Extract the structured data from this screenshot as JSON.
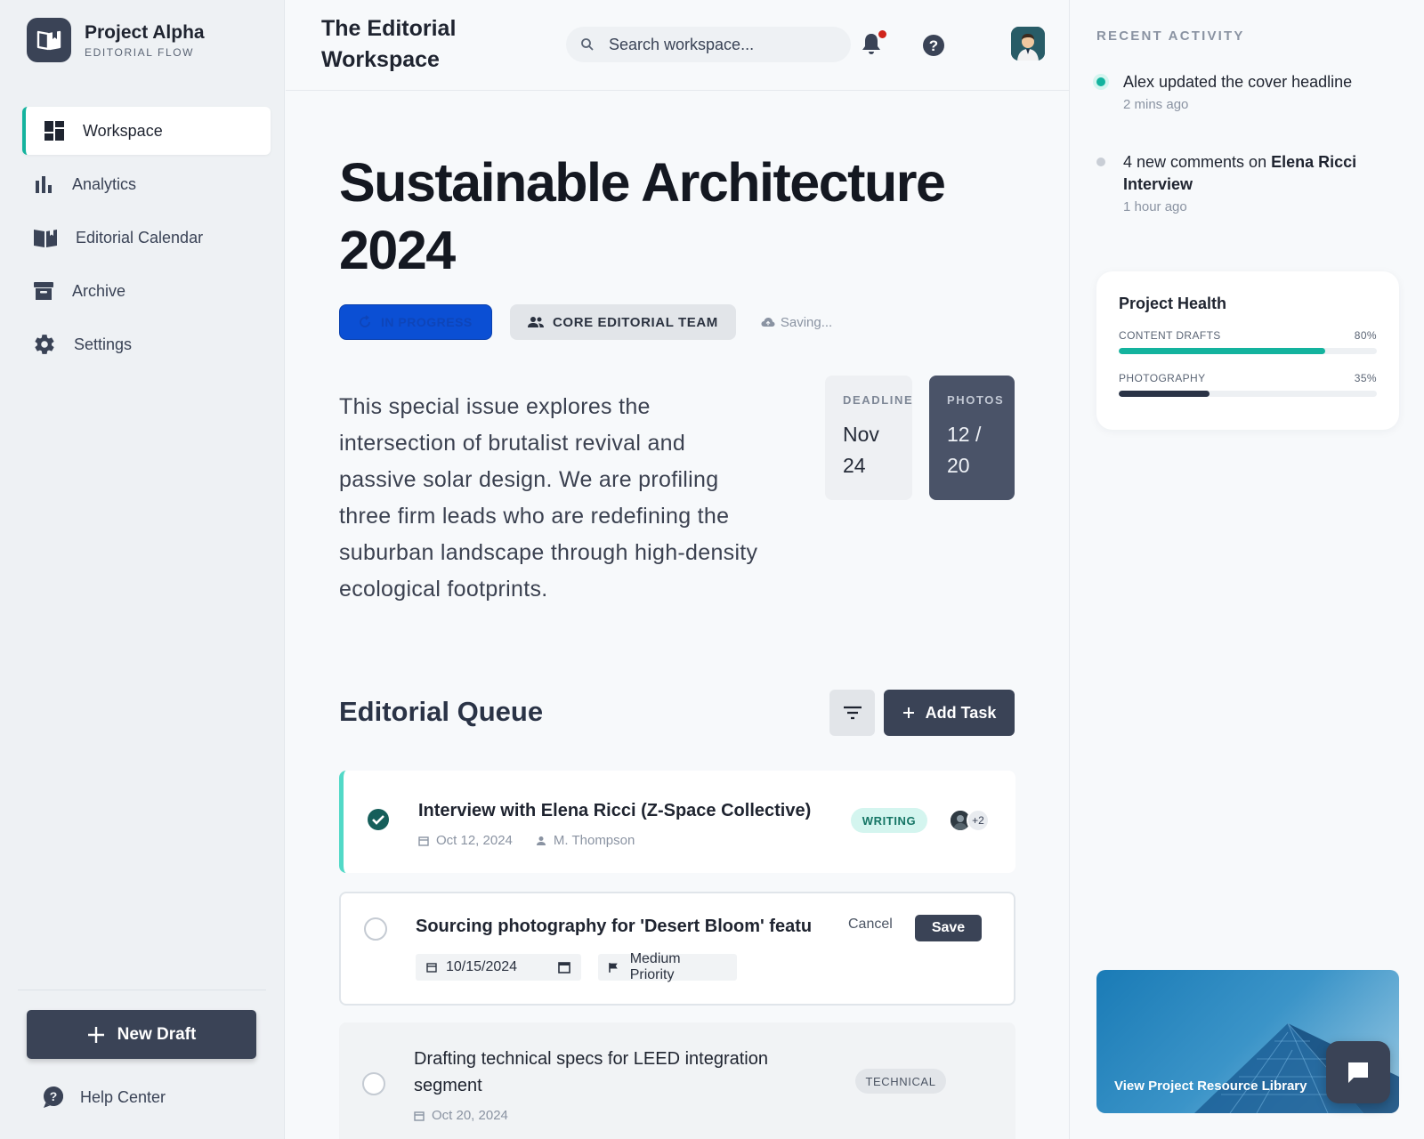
{
  "brand": {
    "title": "Project Alpha",
    "subtitle": "EDITORIAL FLOW"
  },
  "sidebar": {
    "items": [
      {
        "label": "Workspace",
        "icon": "dashboard-icon",
        "active": true
      },
      {
        "label": "Analytics",
        "icon": "bar-chart-icon"
      },
      {
        "label": "Editorial Calendar",
        "icon": "book-icon"
      },
      {
        "label": "Archive",
        "icon": "archive-icon"
      },
      {
        "label": "Settings",
        "icon": "gear-icon"
      }
    ],
    "new_draft_label": "New Draft",
    "help_label": "Help Center"
  },
  "header": {
    "title": "The Editorial Workspace",
    "search_placeholder": "Search workspace..."
  },
  "project": {
    "title": "Sustainable Architecture 2024",
    "status": "IN PROGRESS",
    "team": "CORE EDITORIAL TEAM",
    "save_state": "Saving...",
    "description": "This special issue explores the intersection of brutalist revival and passive solar design. We are profiling three firm leads who are redefining the suburban landscape through high-density ecological footprints.",
    "deadline_label": "DEADLINE",
    "deadline_value": "Nov 24",
    "photos_label": "PHOTOS",
    "photos_value": "12 / 20"
  },
  "queue": {
    "title": "Editorial Queue",
    "add_label": "Add Task",
    "tasks": [
      {
        "title": "Interview with Elena Ricci (Z-Space Collective)",
        "date": "Oct 12, 2024",
        "assignee": "M. Thompson",
        "tag": "WRITING",
        "extra_count": "+2",
        "done": true
      },
      {
        "title": "Sourcing photography for 'Desert Bloom' featu",
        "date": "10/15/2024",
        "priority": "Medium Priority",
        "cancel_label": "Cancel",
        "save_label": "Save",
        "editing": true
      },
      {
        "title": "Drafting technical specs for LEED integration segment",
        "date": "Oct 20, 2024",
        "tag": "TECHNICAL"
      }
    ]
  },
  "activity": {
    "title": "RECENT ACTIVITY",
    "items": [
      {
        "text": "Alex updated the cover headline",
        "time": "2 mins ago",
        "color": "#14b39e"
      },
      {
        "text_prefix": "4 new comments on ",
        "text_highlight": "Elena Ricci Interview",
        "time": "1 hour ago",
        "color": "#c9ced6"
      }
    ]
  },
  "health": {
    "title": "Project Health",
    "metrics": [
      {
        "label": "CONTENT DRAFTS",
        "value": "80%",
        "fraction": 0.8,
        "color": "#14b39e"
      },
      {
        "label": "PHOTOGRAPHY",
        "value": "35%",
        "fraction": 0.35,
        "color": "#2a3346"
      }
    ]
  },
  "resource": {
    "label": "View Project Resource Library"
  },
  "colors": {
    "accent": "#14b39e",
    "primary": "#3a4356",
    "status_blue": "#0b4fd4",
    "alert": "#d0241b"
  }
}
